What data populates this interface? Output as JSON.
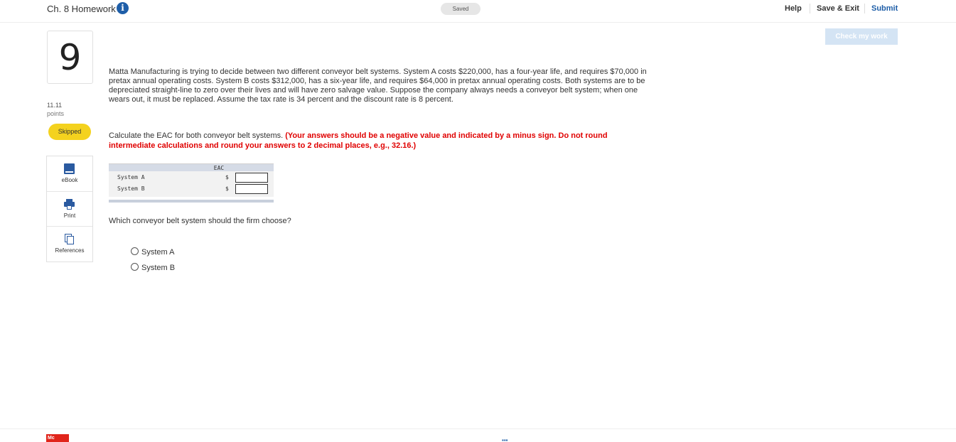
{
  "header": {
    "title": "Ch. 8 Homework",
    "info_icon_glyph": "i",
    "saved_label": "Saved",
    "help_label": "Help",
    "save_exit_label": "Save & Exit",
    "submit_label": "Submit"
  },
  "check_button_label": "Check my work",
  "sidebar": {
    "question_number": "9",
    "points_value": "11.11",
    "points_label": "points",
    "status_badge": "Skipped",
    "resources": [
      {
        "label": "eBook",
        "icon": "book-icon"
      },
      {
        "label": "Print",
        "icon": "printer-icon"
      },
      {
        "label": "References",
        "icon": "copy-icon"
      }
    ]
  },
  "question": {
    "text": "Matta Manufacturing is trying to decide between two different conveyor belt systems. System A costs $220,000, has a four-year life, and requires $70,000 in pretax annual operating costs. System B costs $312,000, has a six-year life, and requires $64,000 in pretax annual operating costs. Both systems are to be depreciated straight-line to zero over their lives and will have zero salvage value. Suppose the company always needs a conveyor belt system; when one wears out, it must be replaced. Assume the tax rate is 34 percent and the discount rate is 8 percent.",
    "instruction_plain": "Calculate the EAC for both conveyor belt systems. ",
    "instruction_bold": "(Your answers should be a negative value and indicated by a minus sign. Do not round intermediate calculations and round your answers to 2 decimal places, e.g., 32.16.)"
  },
  "eac_table": {
    "header": "EAC",
    "rows": [
      {
        "label": "System A",
        "currency": "$",
        "value": ""
      },
      {
        "label": "System B",
        "currency": "$",
        "value": ""
      }
    ]
  },
  "choice": {
    "question": "Which conveyor belt system should the firm choose?",
    "options": [
      "System A",
      "System B"
    ]
  },
  "footer": {
    "logo_text": "Mc",
    "indicator": "▪▪▪"
  },
  "colors": {
    "accent": "#1e5ea8",
    "badge_skipped": "#f4d21e",
    "instruction_red": "#e00000",
    "check_button_bg": "#d4e4f4"
  }
}
